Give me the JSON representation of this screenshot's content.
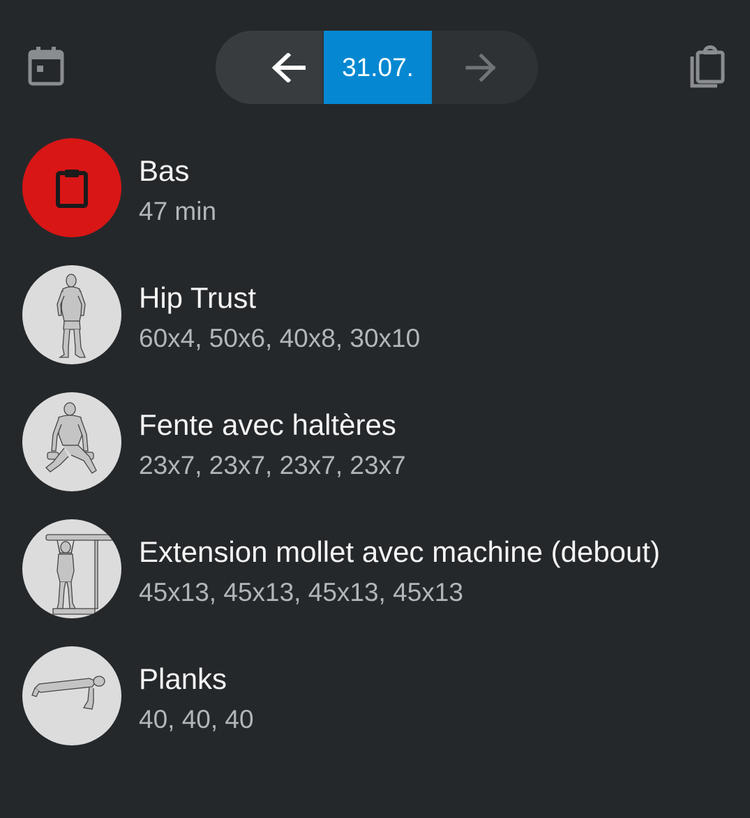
{
  "header": {
    "calendar_icon": "calendar-icon",
    "copy_icon": "copy-icon",
    "date_nav": {
      "prev_icon": "arrow-left-icon",
      "date_label": "31.07.",
      "next_icon": "arrow-right-icon",
      "accent_color": "#0588d1"
    }
  },
  "workout": {
    "icon": "clipboard-icon",
    "icon_bg_color": "#d81616",
    "title": "Bas",
    "duration": "47 min"
  },
  "exercises": [
    {
      "name": "Hip Trust",
      "sets": "60x4, 50x6, 40x8, 30x10",
      "icon": "standing-figure-illustration"
    },
    {
      "name": "Fente avec haltères",
      "sets": "23x7, 23x7, 23x7, 23x7",
      "icon": "lunge-figure-illustration"
    },
    {
      "name": "Extension mollet avec machine (debout)",
      "sets": "45x13, 45x13, 45x13, 45x13",
      "icon": "calf-raise-figure-illustration"
    },
    {
      "name": "Planks",
      "sets": "40, 40, 40",
      "icon": "plank-figure-illustration"
    }
  ]
}
